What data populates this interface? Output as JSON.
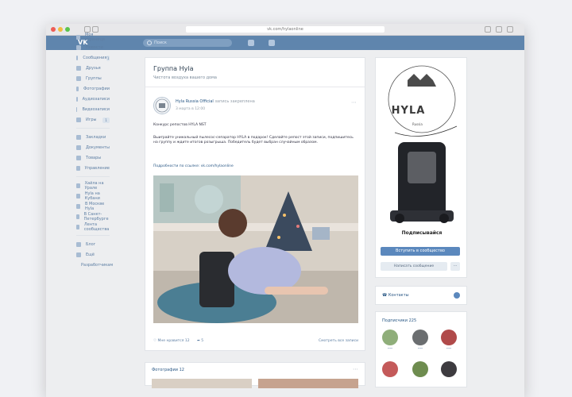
{
  "browser": {
    "url": "vk.com/hylaonline"
  },
  "header": {
    "logo": "VK",
    "search_placeholder": "Поиск"
  },
  "sidebar": {
    "items": [
      {
        "label": "Моя страница",
        "badge": ""
      },
      {
        "label": "Новости",
        "badge": ""
      },
      {
        "label": "Сообщения",
        "badge": "1"
      },
      {
        "label": "Друзья",
        "badge": ""
      },
      {
        "label": "Группы",
        "badge": ""
      },
      {
        "label": "Фотографии",
        "badge": ""
      },
      {
        "label": "Аудиозаписи",
        "badge": ""
      },
      {
        "label": "Видеозаписи",
        "badge": ""
      },
      {
        "label": "Игры",
        "badge": "1"
      }
    ],
    "items2": [
      {
        "label": "Закладки"
      },
      {
        "label": "Документы"
      },
      {
        "label": "Товары"
      },
      {
        "label": "Управление"
      }
    ],
    "items3": [
      {
        "label": "Хайла на Урале"
      },
      {
        "label": "Hyla на Кубани"
      },
      {
        "label": "В Москве Hyla"
      },
      {
        "label": "В Санкт-Петербурге"
      },
      {
        "label": "Лента сообщества"
      }
    ],
    "items4": [
      {
        "label": "Блог"
      },
      {
        "label": "Ещё"
      },
      {
        "label": "Разработчикам"
      }
    ]
  },
  "group": {
    "title": "Группа Hyla",
    "status": "Чистота воздуха вашего дома"
  },
  "post": {
    "author": "Hyla Russia Official",
    "author_suffix": "запись закреплена",
    "date": "3 марта в 12:00",
    "line1": "Конкурс репостов HYLA NST",
    "body": "Выиграйте уникальный пылесос-сепаратор HYLA в подарок! Сделайте репост этой записи, подпишитесь на группу и ждите итогов розыгрыша. Победитель будет выбран случайным образом.",
    "link_line": "Подробности по ссылке: vk.com/hylaonline",
    "footer_likes": "Мне нравится 12",
    "footer_share": "5",
    "footer_views": "Смотреть все записи"
  },
  "promo": {
    "brand": "HYLA",
    "sub_brand": "Russia",
    "caption": "Подписывайся",
    "subscribe_button": "Вступить в сообщество",
    "message_button": "Написать сообщение",
    "more_button": "..."
  },
  "contacts": {
    "label": "Контакты"
  },
  "members": {
    "title": "Подписчики  225"
  },
  "bottom": {
    "title": "Фотографии  12"
  }
}
